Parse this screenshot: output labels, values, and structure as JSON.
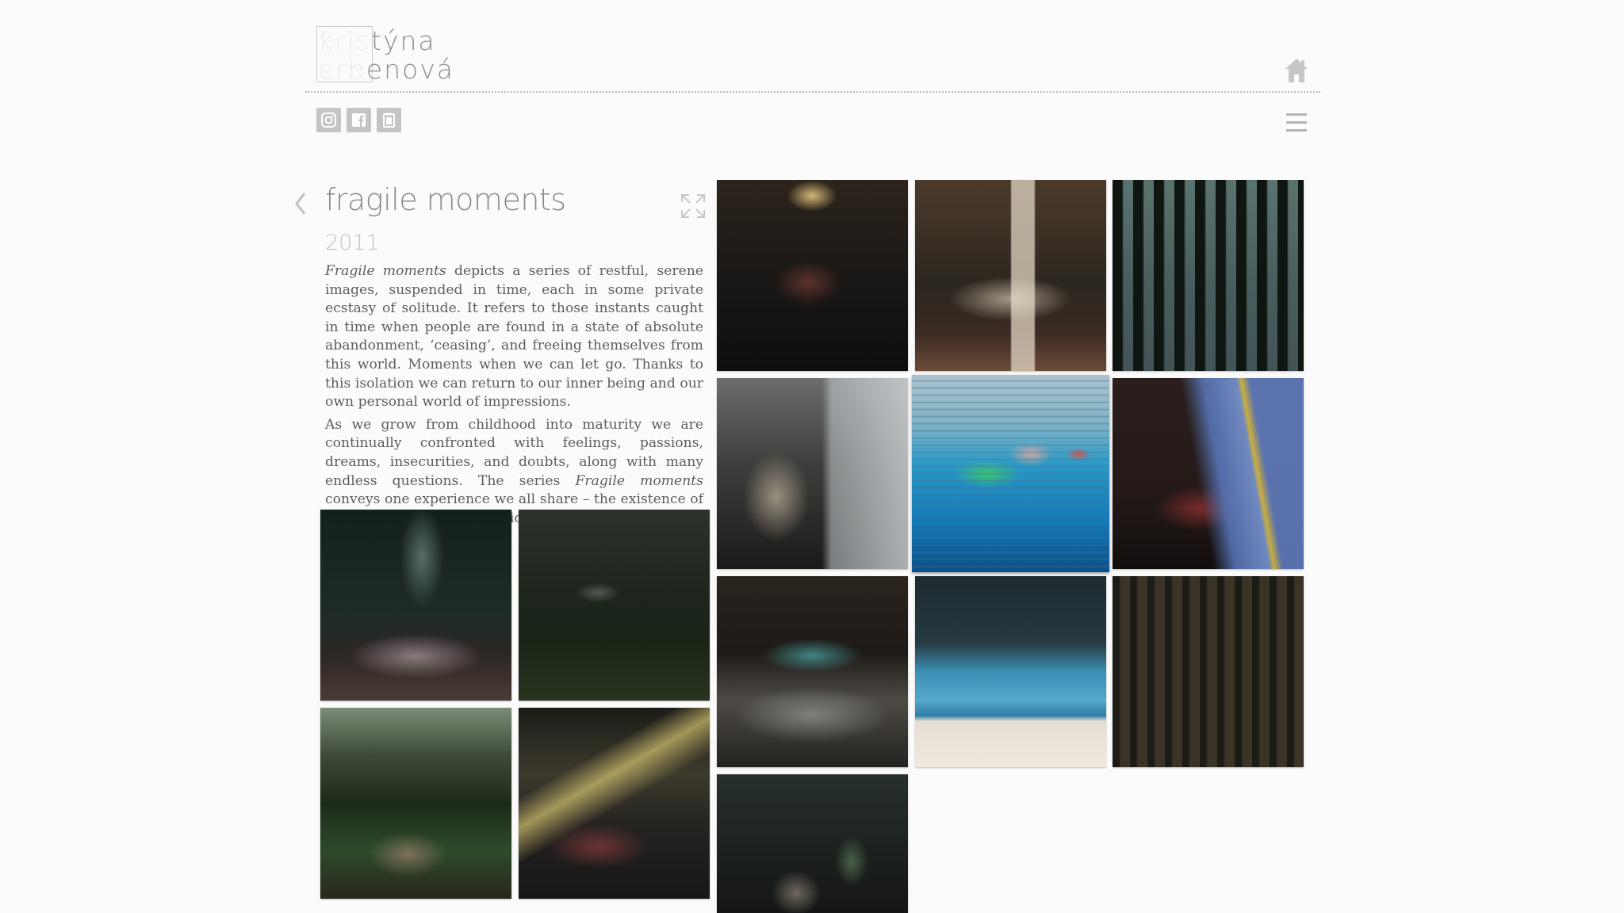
{
  "logo": {
    "boxed_1": "kris",
    "rest_1": "týna",
    "boxed_2": "erb",
    "rest_2": "enová"
  },
  "icons": {
    "home": "home-icon",
    "instagram": "instagram-icon",
    "facebook": "facebook-icon",
    "clipboard": "clipboard-icon",
    "menu": "hamburger-menu-icon",
    "back": "chevron-left-icon",
    "expand": "expand-icon"
  },
  "project": {
    "title": "fragile moments",
    "year": "2011",
    "paragraph1": {
      "lead": "Fragile moments",
      "text": " depicts a series of restful, serene images, suspended in time, each in some private ecstasy of solitude. It refers to those instants caught in time when people are found in a state of absolute abandonment, ‘ceasing’, and freeing themselves from this world. Moments when we can let go. Thanks to this isolation we can return to our inner being and our own personal world of impressions."
    },
    "paragraph2": {
      "before": "As we grow from childhood into maturity we are continually confronted with feelings, passions, dreams, insecurities, and doubts, along with many endless questions. The series ",
      "emph": "Fragile moments",
      "after": " conveys one experience we all share – the existence of our inner world of impressions."
    }
  },
  "colors": {
    "background": "#fbfbfb",
    "text": "#5d5d5d",
    "title": "#8a8a8a",
    "year": "#c2c2c2",
    "social": "#c4c4c4"
  }
}
